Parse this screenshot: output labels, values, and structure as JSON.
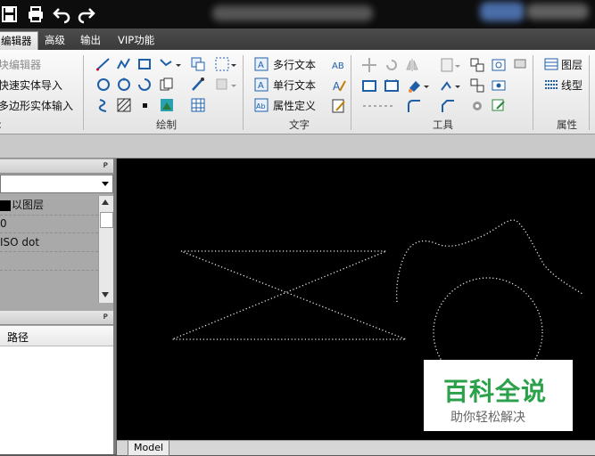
{
  "menu": {
    "tabs": [
      {
        "label": "编辑器",
        "active": true
      },
      {
        "label": "高级",
        "active": false
      },
      {
        "label": "输出",
        "active": false
      },
      {
        "label": "VIP功能",
        "active": false
      }
    ]
  },
  "ribbon": {
    "left_items": [
      "块编辑器",
      "快速实体导入",
      "多边形实体输入"
    ],
    "groups": {
      "draw": "绘制",
      "text": "文字",
      "tools": "工具",
      "props": "属性"
    },
    "text_items": [
      "多行文本",
      "单行文本",
      "属性定义"
    ],
    "prop_items": [
      "图层",
      "线型"
    ]
  },
  "left_panel": {
    "properties": {
      "rows": [
        "以图层",
        "0",
        "ISO dot",
        ""
      ]
    },
    "files": {
      "column_header": "路径"
    }
  },
  "canvas": {
    "background": "#000000",
    "tabs": [
      "Model"
    ]
  },
  "watermark": {
    "title": "百科全说",
    "subtitle": "助你轻松解决"
  },
  "colors": {
    "accent_green": "#2aa14a",
    "ribbon_blue": "#1e5fa8"
  }
}
